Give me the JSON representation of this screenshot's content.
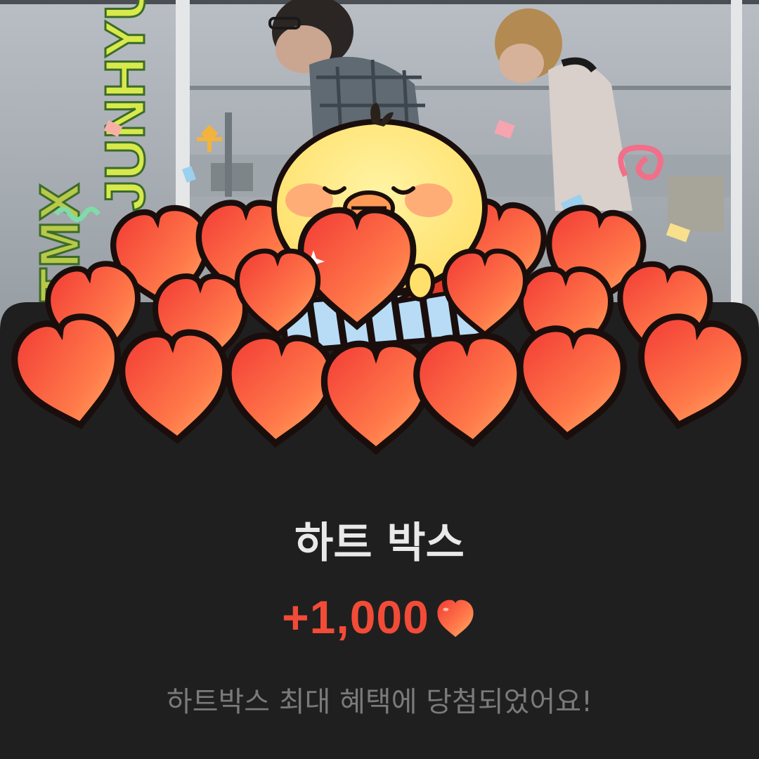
{
  "background": {
    "side_text_left": "TMX",
    "side_text_right": "JUNHYUK"
  },
  "reward": {
    "title": "하트 박스",
    "amount": "+1,000",
    "currency_icon": "heart-icon",
    "description": "하트박스 최대 혜택에 당첨되었어요!"
  },
  "colors": {
    "accent": "#f24b38",
    "sheet": "#1f1f1f",
    "title": "#e9e9e9",
    "description": "#7a7a7a",
    "heart_light": "#ff9f5e",
    "heart_dark": "#f23a35",
    "chick": "#ffe87a"
  }
}
